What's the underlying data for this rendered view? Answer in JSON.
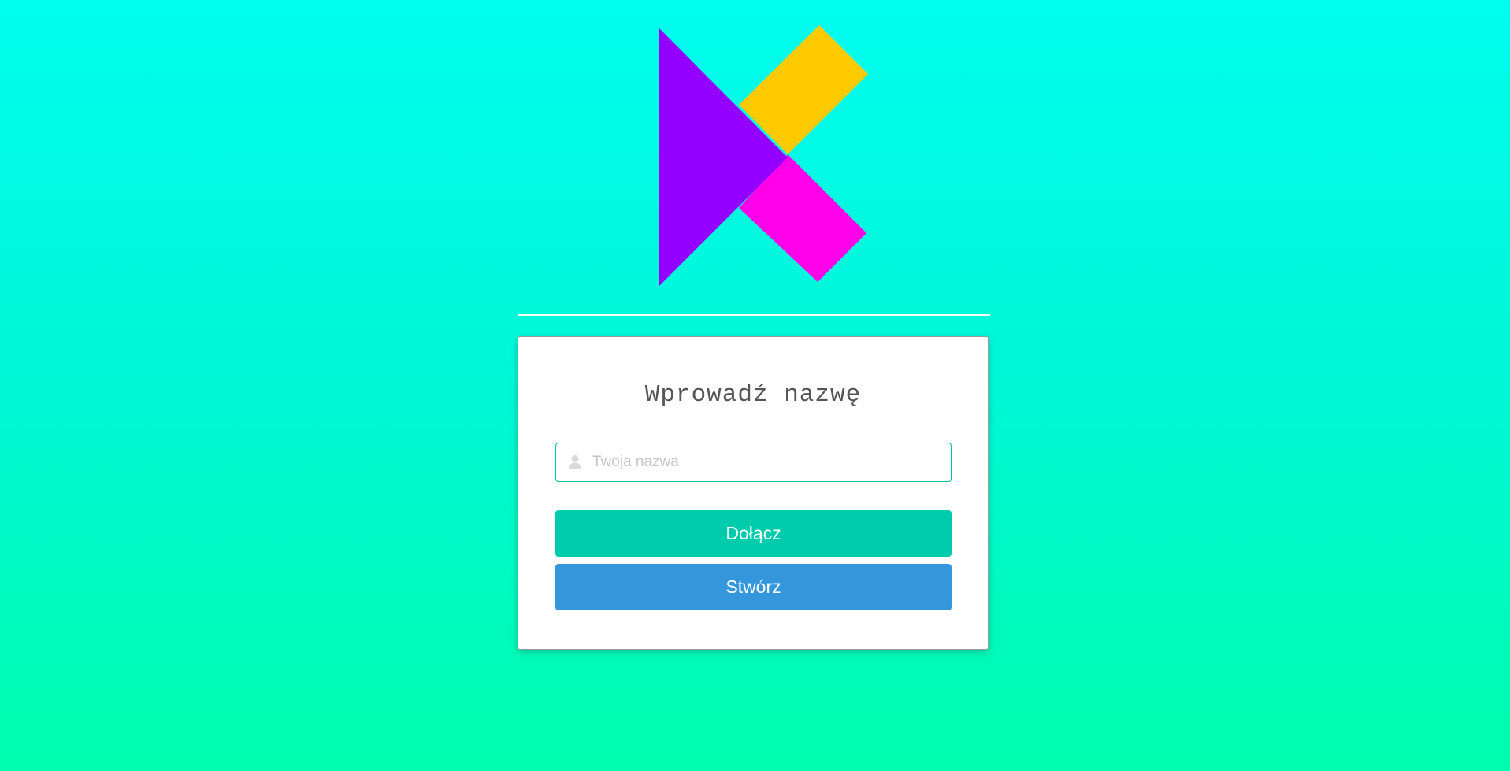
{
  "logo": {
    "name": "K logo",
    "colors": {
      "left": "#9300ff",
      "top_right": "#ffcb00",
      "bottom_right": "#ff00e8"
    }
  },
  "card": {
    "title": "Wprowadź nazwę",
    "name_input": {
      "value": "",
      "placeholder": "Twoja nazwa",
      "icon": "user-icon"
    },
    "join_button": {
      "label": "Dołącz",
      "color": "#00cbac"
    },
    "create_button": {
      "label": "Stwórz",
      "color": "#3497dc"
    }
  },
  "colors": {
    "background_top": "#00fdee",
    "background_bottom": "#00fcad",
    "input_border": "#00c4a7"
  }
}
